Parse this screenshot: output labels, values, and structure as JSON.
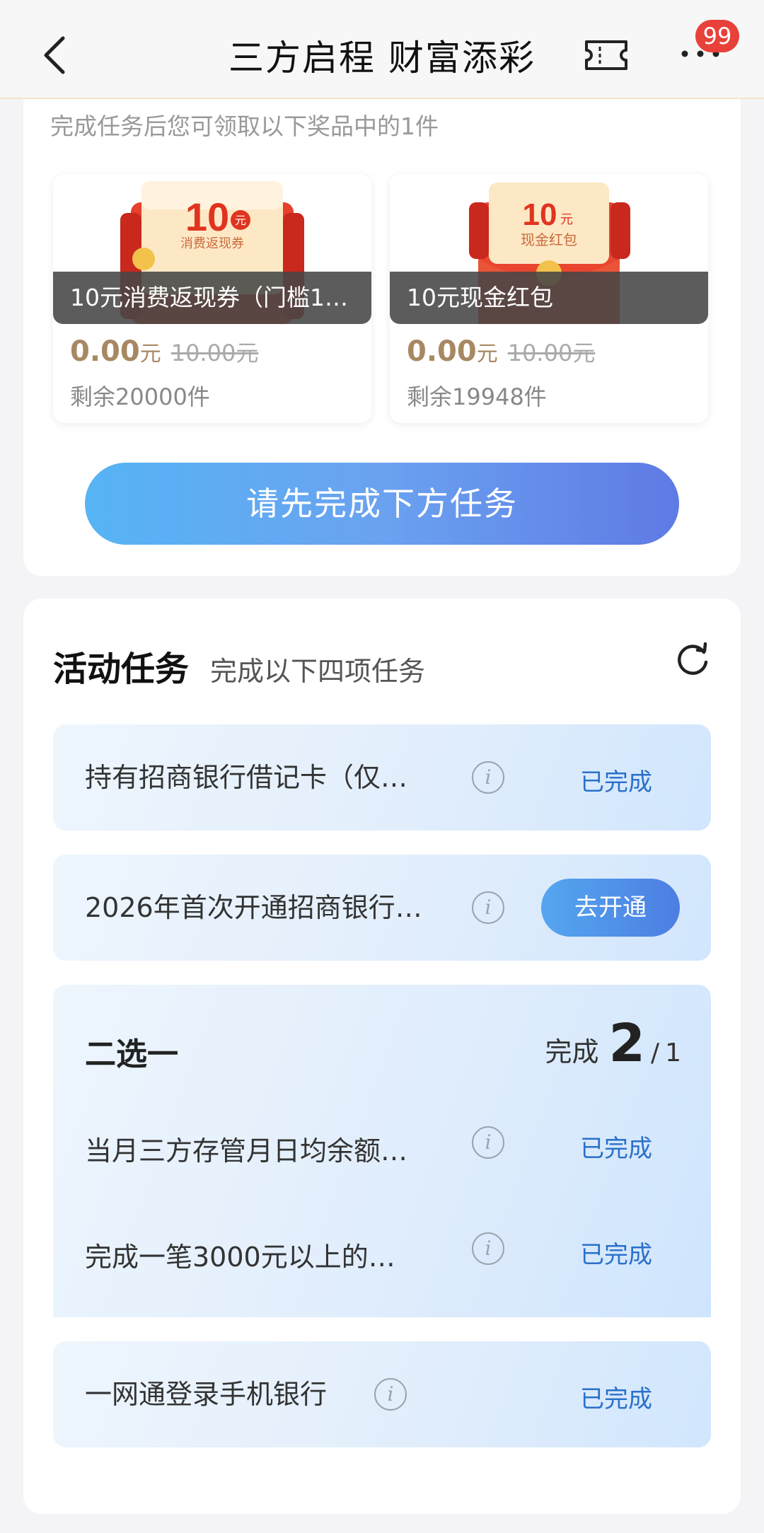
{
  "header": {
    "title": "三方启程 财富添彩",
    "badge": "99"
  },
  "rewards": {
    "subtitle": "完成任务后您可领取以下奖品中的1件",
    "items": [
      {
        "img_amount": "10",
        "img_unit": "元",
        "img_caption": "消费返现券",
        "name": "10元消费返现券（门槛10…",
        "price": "0.00",
        "price_unit": "元",
        "original": "10.00元",
        "remain": "剩余20000件"
      },
      {
        "img_amount": "10",
        "img_unit": "元",
        "img_caption": "现金红包",
        "name": "10元现金红包",
        "price": "0.00",
        "price_unit": "元",
        "original": "10.00元",
        "remain": "剩余19948件"
      }
    ],
    "action_label": "请先完成下方任务"
  },
  "tasks": {
    "title": "活动任务",
    "subtitle": "完成以下四项任务",
    "items": [
      {
        "text": "持有招商银行借记卡（仅…",
        "status": "已完成"
      },
      {
        "text": "2026年首次开通招商银行…",
        "action": "去开通"
      },
      {
        "text": "一网通登录手机银行",
        "status": "已完成"
      }
    ],
    "group": {
      "title": "二选一",
      "progress_label": "完成",
      "progress_done": "2",
      "progress_total": "1",
      "items": [
        {
          "text": "当月三方存管月日均余额…",
          "status": "已完成"
        },
        {
          "text": "完成一笔3000元以上的…",
          "status": "已完成"
        }
      ]
    }
  },
  "colors": {
    "accent_blue": "#2a70c9",
    "price_gold": "#a88862",
    "badge_red": "#e8413a"
  }
}
